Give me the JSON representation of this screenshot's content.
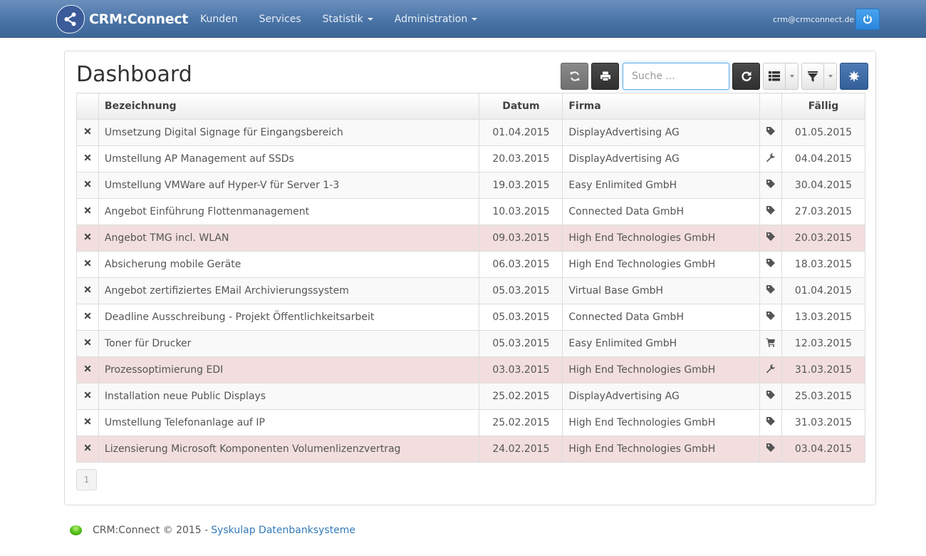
{
  "navbar": {
    "brand": "CRM:Connect",
    "links": [
      {
        "label": "Kunden",
        "dropdown": false
      },
      {
        "label": "Services",
        "dropdown": false
      },
      {
        "label": "Statistik",
        "dropdown": true
      },
      {
        "label": "Administration",
        "dropdown": true
      }
    ],
    "user_email": "crm@crmconnect.de",
    "power_icon": "power-icon"
  },
  "page": {
    "title": "Dashboard"
  },
  "toolbar": {
    "sync_icon": "sync-icon",
    "print_icon": "print-icon",
    "search": {
      "placeholder": "Suche ...",
      "value": ""
    },
    "refresh_icon": "refresh-icon",
    "columns_icon": "list-icon",
    "filter_icon": "filter-icon",
    "settings_icon": "cog-icon"
  },
  "table": {
    "headers": {
      "delete": "",
      "name": "Bezeichnung",
      "date": "Datum",
      "company": "Firma",
      "type": "",
      "due": "Fällig"
    },
    "rows": [
      {
        "name": "Umsetzung Digital Signage für Eingangsbereich",
        "date": "01.04.2015",
        "company": "DisplayAdvertising AG",
        "type": "tag",
        "due": "01.05.2015",
        "overdue": false
      },
      {
        "name": "Umstellung AP Management auf SSDs",
        "date": "20.03.2015",
        "company": "DisplayAdvertising AG",
        "type": "wrench",
        "due": "04.04.2015",
        "overdue": false
      },
      {
        "name": "Umstellung VMWare auf Hyper-V für Server 1-3",
        "date": "19.03.2015",
        "company": "Easy Enlimited GmbH",
        "type": "tag",
        "due": "30.04.2015",
        "overdue": false
      },
      {
        "name": "Angebot Einführung Flottenmanagement",
        "date": "10.03.2015",
        "company": "Connected Data GmbH",
        "type": "tag",
        "due": "27.03.2015",
        "overdue": false
      },
      {
        "name": "Angebot TMG incl. WLAN",
        "date": "09.03.2015",
        "company": "High End Technologies GmbH",
        "type": "tag",
        "due": "20.03.2015",
        "overdue": true
      },
      {
        "name": "Absicherung mobile Geräte",
        "date": "06.03.2015",
        "company": "High End Technologies GmbH",
        "type": "tag",
        "due": "18.03.2015",
        "overdue": false
      },
      {
        "name": "Angebot zertifiziertes EMail Archivierungssystem",
        "date": "05.03.2015",
        "company": "Virtual Base GmbH",
        "type": "tag",
        "due": "01.04.2015",
        "overdue": false
      },
      {
        "name": "Deadline Ausschreibung - Projekt Öffentlichkeitsarbeit",
        "date": "05.03.2015",
        "company": "Connected Data GmbH",
        "type": "tag",
        "due": "13.03.2015",
        "overdue": false
      },
      {
        "name": "Toner für Drucker",
        "date": "05.03.2015",
        "company": "Easy Enlimited GmbH",
        "type": "cart",
        "due": "12.03.2015",
        "overdue": false
      },
      {
        "name": "Prozessoptimierung EDI",
        "date": "03.03.2015",
        "company": "High End Technologies GmbH",
        "type": "wrench",
        "due": "31.03.2015",
        "overdue": true
      },
      {
        "name": "Installation neue Public Displays",
        "date": "25.02.2015",
        "company": "DisplayAdvertising AG",
        "type": "tag",
        "due": "25.03.2015",
        "overdue": false
      },
      {
        "name": "Umstellung Telefonanlage auf IP",
        "date": "25.02.2015",
        "company": "High End Technologies GmbH",
        "type": "tag",
        "due": "31.03.2015",
        "overdue": false
      },
      {
        "name": "Lizensierung Microsoft Komponenten Volumenlizenzvertrag",
        "date": "24.02.2015",
        "company": "High End Technologies GmbH",
        "type": "tag",
        "due": "03.04.2015",
        "overdue": true
      }
    ]
  },
  "pagination": {
    "current": "1"
  },
  "footer": {
    "text": "CRM:Connect © 2015 -",
    "link": "Syskulap Datenbanksysteme",
    "status": "online"
  },
  "colors": {
    "navbar": "#4a74a6",
    "overdue_row": "#f2dede",
    "link": "#337ab7",
    "primary_button": "#2a86dc"
  }
}
